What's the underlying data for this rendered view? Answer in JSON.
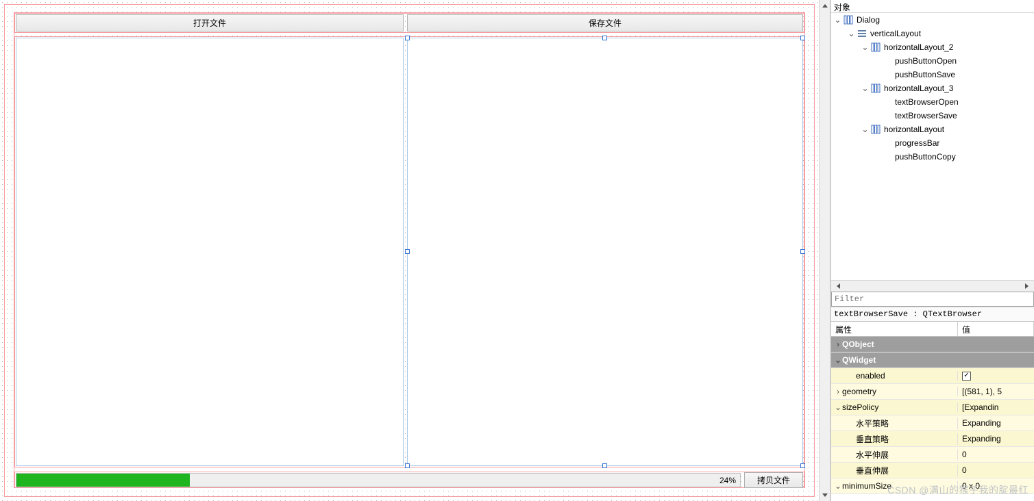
{
  "designer": {
    "buttons": {
      "open": "打开文件",
      "save": "保存文件",
      "copy": "拷贝文件"
    },
    "progress": {
      "percent": 24,
      "label": "24%"
    }
  },
  "inspector": {
    "header": "对象",
    "tree": [
      {
        "depth": 0,
        "expand": true,
        "icon": "layout",
        "label": "Dialog"
      },
      {
        "depth": 1,
        "expand": true,
        "icon": "widget",
        "label": "verticalLayout"
      },
      {
        "depth": 2,
        "expand": true,
        "icon": "layout",
        "label": "horizontalLayout_2"
      },
      {
        "depth": 3,
        "expand": null,
        "icon": "none",
        "label": "pushButtonOpen"
      },
      {
        "depth": 3,
        "expand": null,
        "icon": "none",
        "label": "pushButtonSave"
      },
      {
        "depth": 2,
        "expand": true,
        "icon": "layout",
        "label": "horizontalLayout_3"
      },
      {
        "depth": 3,
        "expand": null,
        "icon": "none",
        "label": "textBrowserOpen"
      },
      {
        "depth": 3,
        "expand": null,
        "icon": "none",
        "label": "textBrowserSave"
      },
      {
        "depth": 2,
        "expand": true,
        "icon": "layout",
        "label": "horizontalLayout"
      },
      {
        "depth": 3,
        "expand": null,
        "icon": "none",
        "label": "progressBar"
      },
      {
        "depth": 3,
        "expand": null,
        "icon": "none",
        "label": "pushButtonCopy"
      }
    ]
  },
  "filter": {
    "placeholder": "Filter"
  },
  "selected_object": "textBrowserSave : QTextBrowser",
  "prop_header": {
    "name": "属性",
    "value": "值"
  },
  "properties": [
    {
      "kind": "section",
      "name": "QObject",
      "arrow": "right"
    },
    {
      "kind": "section",
      "name": "QWidget",
      "arrow": "down"
    },
    {
      "kind": "prop",
      "shade": "A",
      "indent": 1,
      "arrow": "",
      "name": "enabled",
      "value_type": "check",
      "checked": true
    },
    {
      "kind": "prop",
      "shade": "B",
      "indent": 0,
      "arrow": "right",
      "name": "geometry",
      "value": "[(581, 1), 5"
    },
    {
      "kind": "prop",
      "shade": "A",
      "indent": 0,
      "arrow": "down",
      "name": "sizePolicy",
      "value": "[Expandin"
    },
    {
      "kind": "prop",
      "shade": "B",
      "indent": 1,
      "arrow": "",
      "name": "水平策略",
      "value": "Expanding"
    },
    {
      "kind": "prop",
      "shade": "A",
      "indent": 1,
      "arrow": "",
      "name": "垂直策略",
      "value": "Expanding"
    },
    {
      "kind": "prop",
      "shade": "B",
      "indent": 1,
      "arrow": "",
      "name": "水平伸展",
      "value": "0"
    },
    {
      "kind": "prop",
      "shade": "A",
      "indent": 1,
      "arrow": "",
      "name": "垂直伸展",
      "value": "0"
    },
    {
      "kind": "prop",
      "shade": "B",
      "indent": 0,
      "arrow": "down",
      "name": "minimumSize",
      "value": "0 x 0"
    }
  ],
  "watermark": "CSDN @满山的猴子我的腚最红"
}
